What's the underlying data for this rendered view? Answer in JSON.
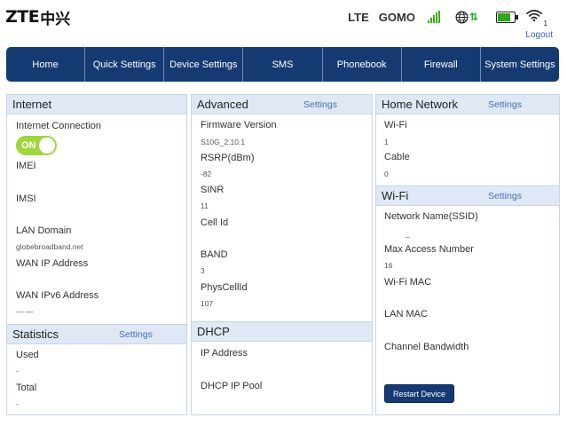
{
  "header": {
    "logo_latin": "ZTE",
    "logo_cn": "中兴",
    "network_type": "LTE",
    "carrier": "GOMO",
    "signal_icon": "signal-bars-icon",
    "globe_icon": "globe-icon",
    "data_arrows": "⇅",
    "battery_icon": "battery-icon",
    "battery_level": 0.7,
    "wifi_icon": "wifi-icon",
    "wifi_clients": "1",
    "logout": "Logout"
  },
  "colors": {
    "nav_bg": "#153a72",
    "panel_header_bg": "#dfe8f4",
    "link": "#4470b8",
    "toggle_on": "#9fd63e",
    "signal_green": "#38b000"
  },
  "nav": {
    "items": [
      "Home",
      "Quick Settings",
      "Device Settings",
      "SMS",
      "Phonebook",
      "Firewall",
      "System Settings"
    ]
  },
  "internet": {
    "title": "Internet",
    "connection_label": "Internet Connection",
    "toggle_state": "ON",
    "imei_label": "IMEI",
    "imei_value": "",
    "imsi_label": "IMSI",
    "imsi_value": "",
    "lan_domain_label": "LAN Domain",
    "lan_domain_value": "globebroadband.net",
    "wan_ip_label": "WAN IP Address",
    "wan_ip_value": "",
    "wan_ipv6_label": "WAN IPv6 Address",
    "wan_ipv6_value": "— —"
  },
  "statistics": {
    "title": "Statistics",
    "settings": "Settings",
    "used_label": "Used",
    "used_value": "-",
    "total_label": "Total",
    "total_value": "-"
  },
  "advanced": {
    "title": "Advanced",
    "settings": "Settings",
    "firmware_label": "Firmware Version",
    "firmware_value": "S10G_2.10.1",
    "rsrp_label": "RSRP(dBm)",
    "rsrp_value": "-82",
    "sinr_label": "SINR",
    "sinr_value": "11",
    "cellid_label": "Cell Id",
    "cellid_value": "",
    "band_label": "BAND",
    "band_value": "3",
    "physcellid_label": "PhysCellId",
    "physcellid_value": "107"
  },
  "dhcp": {
    "title": "DHCP",
    "ip_label": "IP Address",
    "ip_value": "",
    "pool_label": "DHCP IP Pool",
    "pool_value": ""
  },
  "home_network": {
    "title": "Home Network",
    "settings": "Settings",
    "wifi_label": "Wi-Fi",
    "wifi_value": "1",
    "cable_label": "Cable",
    "cable_value": "0"
  },
  "wifi": {
    "title": "Wi-Fi",
    "settings": "Settings",
    "ssid_label": "Network Name(SSID)",
    "ssid_value": "_",
    "max_access_label": "Max Access Number",
    "max_access_value": "16",
    "wifi_mac_label": "Wi-Fi MAC",
    "wifi_mac_value": "",
    "lan_mac_label": "LAN MAC",
    "lan_mac_value": "",
    "bandwidth_label": "Channel Bandwidth",
    "bandwidth_value": "",
    "restart_button": "Restart Device"
  }
}
